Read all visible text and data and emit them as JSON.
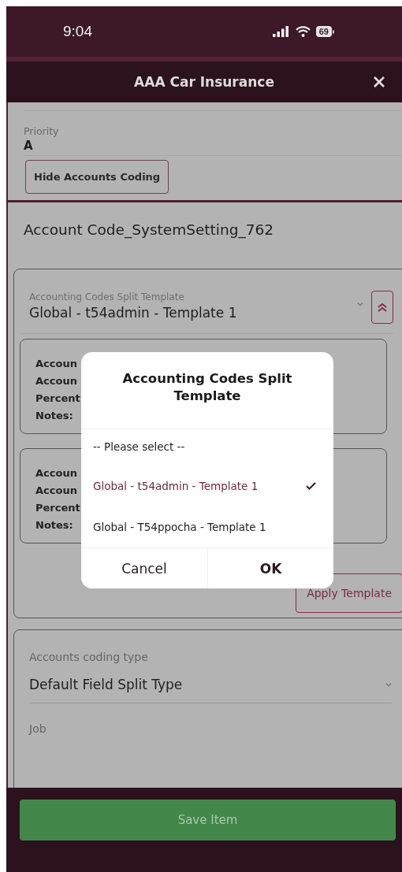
{
  "status_bar": {
    "time": "9:04",
    "battery": "69"
  },
  "header": {
    "title": "AAA Car Insurance"
  },
  "form": {
    "priority": {
      "label": "Priority",
      "value": "A"
    },
    "hide_button": "Hide Accounts Coding",
    "section_title": "Account Code_SystemSetting_762",
    "template": {
      "label": "Accounting Codes Split Template",
      "value": "Global - t54admin - Template 1",
      "expanded": true
    },
    "splits": [
      {
        "lines": [
          "Accoun",
          "Accoun",
          "Percent",
          "Notes:"
        ]
      },
      {
        "lines": [
          "Accoun",
          "Accoun",
          "Percent",
          "Notes:"
        ]
      }
    ],
    "apply_button": "Apply Template",
    "coding": {
      "type_label": "Accounts coding type",
      "type_value": "Default Field Split Type",
      "job_label": "Job"
    }
  },
  "dialog": {
    "title": "Accounting Codes Split Template",
    "options": [
      {
        "label": "-- Please select --",
        "selected": false
      },
      {
        "label": "Global - t54admin - Template 1",
        "selected": true
      },
      {
        "label": "Global - T54ppocha - Template 1",
        "selected": false
      }
    ],
    "buttons": [
      "Cancel",
      "OK"
    ]
  },
  "footer": {
    "save_button": "Save Item"
  }
}
